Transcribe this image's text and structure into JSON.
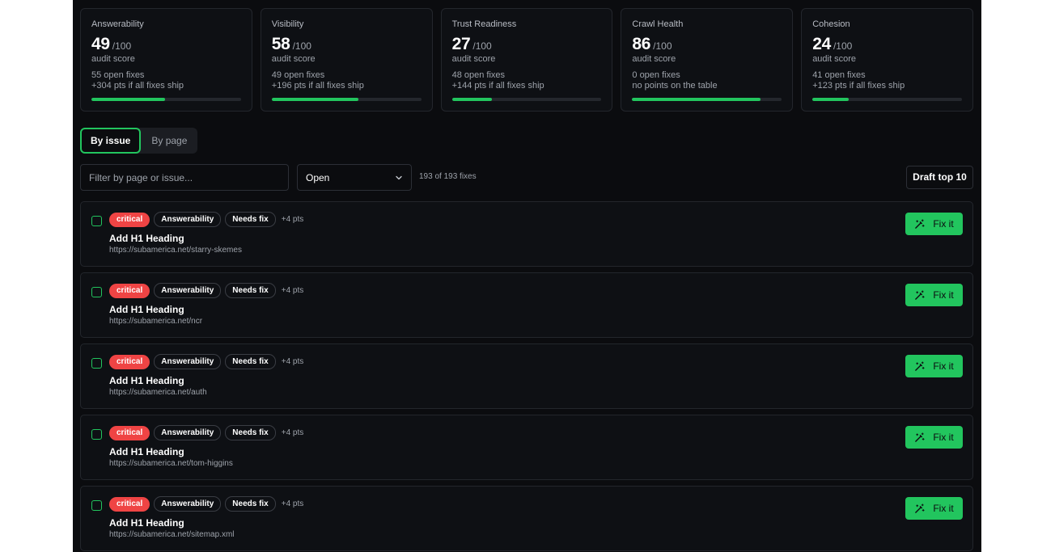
{
  "cards": [
    {
      "title": "Answerability",
      "score": "49",
      "max": "/100",
      "caption": "audit score",
      "fixes": "55 open fixes",
      "gain": "+304 pts if all fixes ship",
      "progress": 0.49
    },
    {
      "title": "Visibility",
      "score": "58",
      "max": "/100",
      "caption": "audit score",
      "fixes": "49 open fixes",
      "gain": "+196 pts if all fixes ship",
      "progress": 0.58
    },
    {
      "title": "Trust Readiness",
      "score": "27",
      "max": "/100",
      "caption": "audit score",
      "fixes": "48 open fixes",
      "gain": "+144 pts if all fixes ship",
      "progress": 0.27
    },
    {
      "title": "Crawl Health",
      "score": "86",
      "max": "/100",
      "caption": "audit score",
      "fixes": "0 open fixes",
      "gain": "no points on the table",
      "progress": 0.86
    },
    {
      "title": "Cohesion",
      "score": "24",
      "max": "/100",
      "caption": "audit score",
      "fixes": "41 open fixes",
      "gain": "+123 pts if all fixes ship",
      "progress": 0.24
    }
  ],
  "tabs": {
    "by_issue": "By issue",
    "by_page": "By page"
  },
  "filter": {
    "placeholder": "Filter by page or issue..."
  },
  "status_select": {
    "value": "Open"
  },
  "count": "193 of 193 fixes",
  "draft_button": "Draft top 10",
  "colors": {
    "accent": "#22c55e",
    "critical": "#ef4444",
    "background": "#0b0c0f"
  },
  "issues": [
    {
      "severity": "critical",
      "category": "Answerability",
      "status": "Needs fix",
      "pts": "+4 pts",
      "title": "Add H1 Heading",
      "url": "https://subamerica.net/starry-skemes",
      "action": "Fix it"
    },
    {
      "severity": "critical",
      "category": "Answerability",
      "status": "Needs fix",
      "pts": "+4 pts",
      "title": "Add H1 Heading",
      "url": "https://subamerica.net/ncr",
      "action": "Fix it"
    },
    {
      "severity": "critical",
      "category": "Answerability",
      "status": "Needs fix",
      "pts": "+4 pts",
      "title": "Add H1 Heading",
      "url": "https://subamerica.net/auth",
      "action": "Fix it"
    },
    {
      "severity": "critical",
      "category": "Answerability",
      "status": "Needs fix",
      "pts": "+4 pts",
      "title": "Add H1 Heading",
      "url": "https://subamerica.net/tom-higgins",
      "action": "Fix it"
    },
    {
      "severity": "critical",
      "category": "Answerability",
      "status": "Needs fix",
      "pts": "+4 pts",
      "title": "Add H1 Heading",
      "url": "https://subamerica.net/sitemap.xml",
      "action": "Fix it"
    }
  ]
}
